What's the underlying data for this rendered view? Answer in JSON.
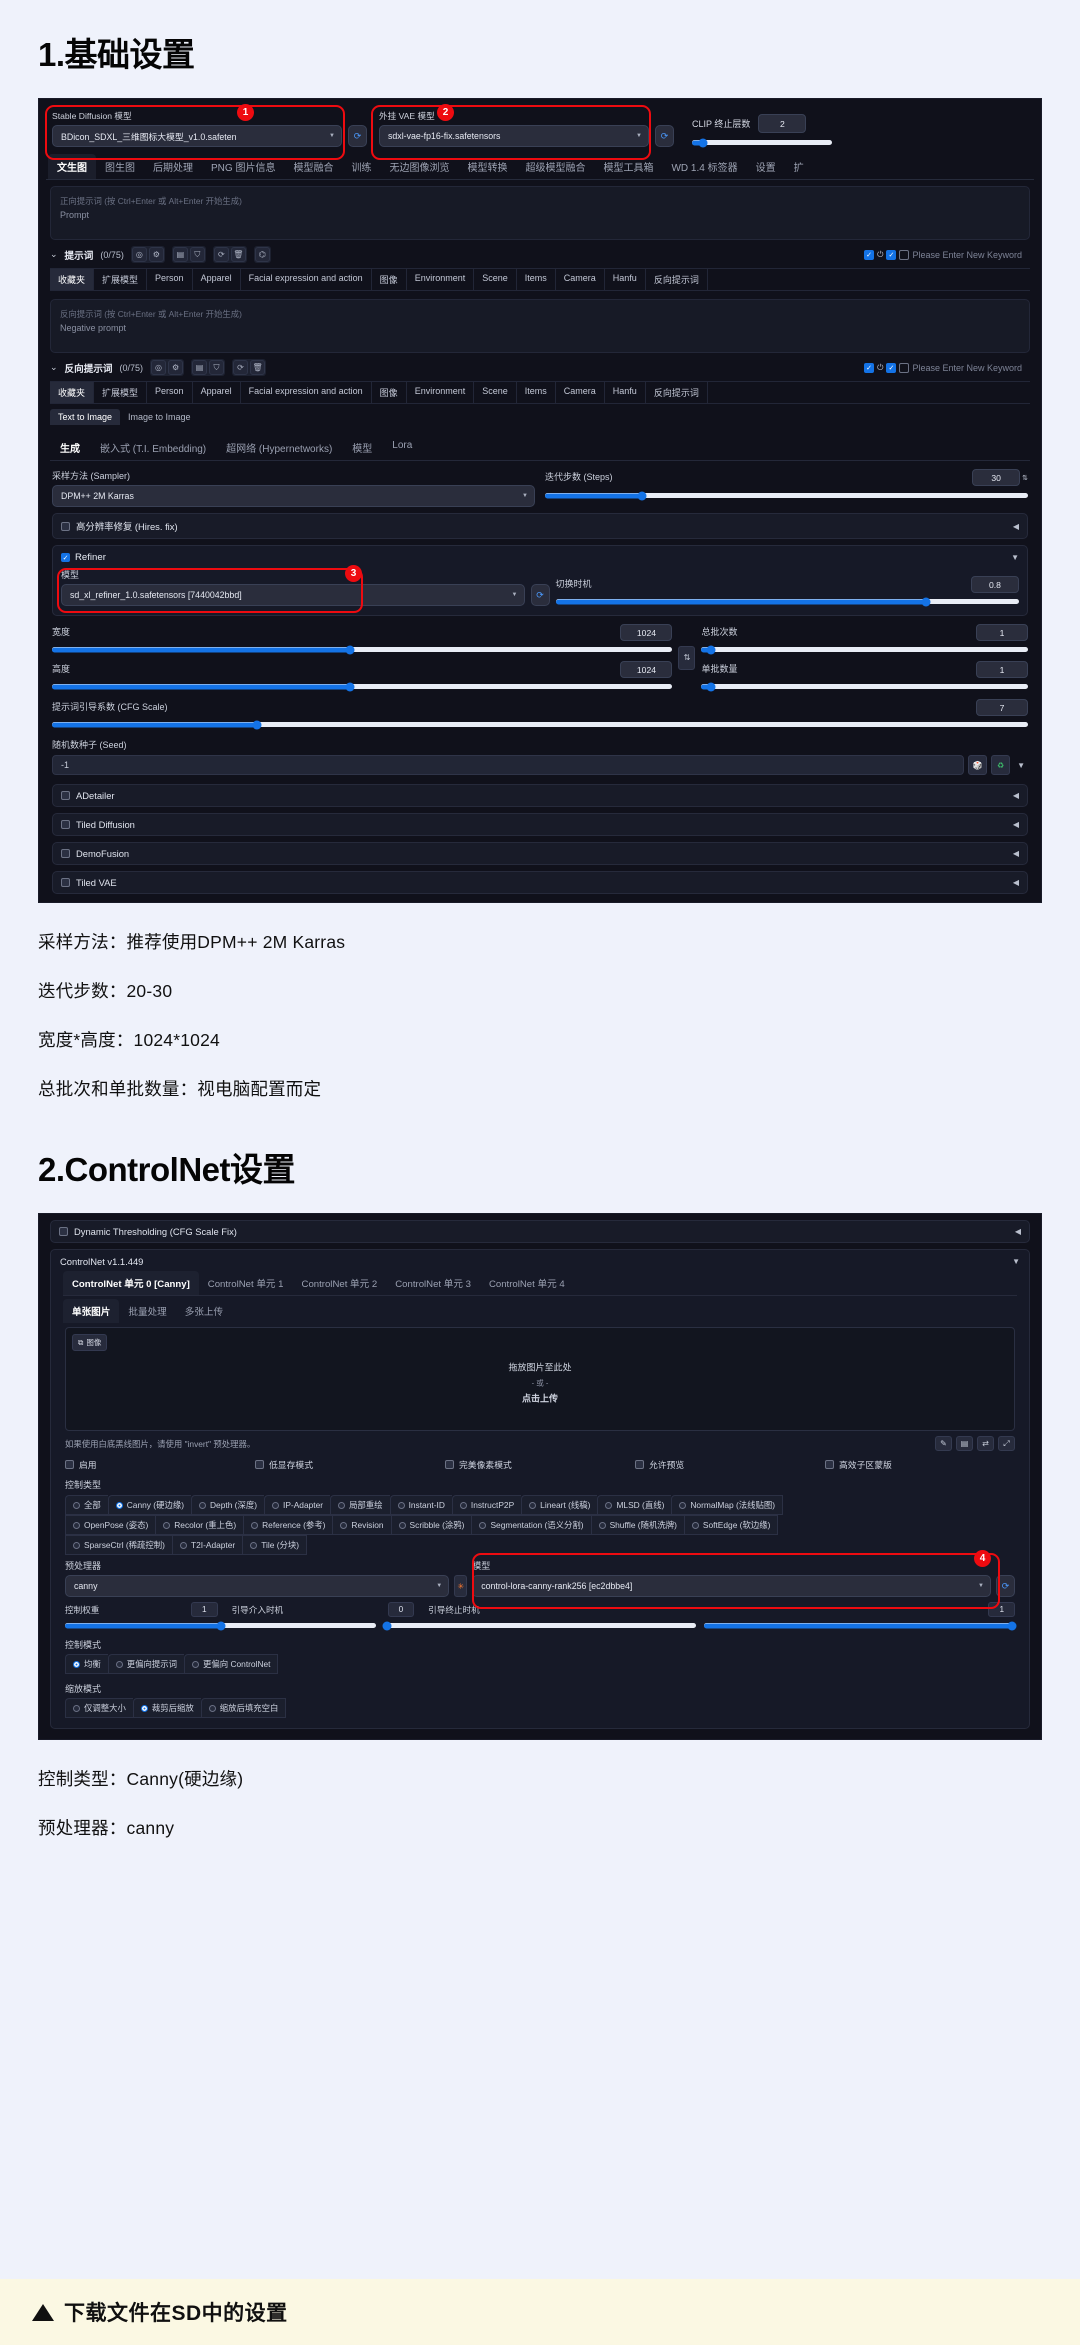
{
  "section1": {
    "heading": "1.基础设置",
    "topbar": {
      "sd_model_label": "Stable Diffusion 模型",
      "sd_model_value": "BDicon_SDXL_三维图标大模型_v1.0.safeten",
      "vae_label": "外挂 VAE 模型",
      "vae_value": "sdxl-vae-fp16-fix.safetensors",
      "clip_label": "CLIP 终止层数",
      "clip_value": "2",
      "refresh_icon": "refresh-icon",
      "badge1": "1",
      "badge2": "2"
    },
    "tabs": [
      "文生图",
      "图生图",
      "后期处理",
      "PNG 图片信息",
      "模型融合",
      "训练",
      "无边图像浏览",
      "模型转换",
      "超级模型融合",
      "模型工具箱",
      "WD 1.4 标签器",
      "设置",
      "扩"
    ],
    "active_tab": "文生图",
    "positive_prompt": {
      "hint": "正向提示词 (按 Ctrl+Enter 或 Alt+Enter 开始生成)",
      "placeholder": "Prompt",
      "title": "提示词",
      "count": "(0/75)",
      "keyword_placeholder": "Please Enter New Keyword"
    },
    "negative_prompt": {
      "hint": "反向提示词 (按 Ctrl+Enter 或 Alt+Enter 开始生成)",
      "placeholder": "Negative prompt",
      "title": "反向提示词",
      "count": "(0/75)",
      "keyword_placeholder": "Please Enter New Keyword"
    },
    "chips": [
      "收藏夹",
      "扩展模型",
      "Person",
      "Apparel",
      "Facial expression and action",
      "图像",
      "Environment",
      "Scene",
      "Items",
      "Camera",
      "Hanfu",
      "反向提示词"
    ],
    "subtabs": [
      "Text to Image",
      "Image to Image"
    ],
    "gen_tabs": [
      "生成",
      "嵌入式 (T.I. Embedding)",
      "超网络 (Hypernetworks)",
      "模型",
      "Lora"
    ],
    "sampler_label": "采样方法 (Sampler)",
    "sampler_value": "DPM++ 2M Karras",
    "steps_label": "迭代步数 (Steps)",
    "steps_value": "30",
    "hires_label": "高分辨率修复 (Hires. fix)",
    "refiner": {
      "title": "Refiner",
      "model_label": "模型",
      "model_value": "sd_xl_refiner_1.0.safetensors [7440042bbd]",
      "switch_label": "切换时机",
      "switch_value": "0.8",
      "badge3": "3"
    },
    "width_label": "宽度",
    "width_value": "1024",
    "height_label": "高度",
    "height_value": "1024",
    "batch_count_label": "总批次数",
    "batch_count_value": "1",
    "batch_size_label": "单批数量",
    "batch_size_value": "1",
    "swap_icon": "swap-arrows-icon",
    "cfg_label": "提示词引导系数 (CFG Scale)",
    "cfg_value": "7",
    "seed_label": "随机数种子 (Seed)",
    "seed_value": "-1",
    "seed_icons": [
      "dice-icon",
      "recycle-icon",
      "chevron-down-icon"
    ],
    "accordions": [
      "ADetailer",
      "Tiled Diffusion",
      "DemoFusion",
      "Tiled VAE"
    ],
    "captions": [
      "采样方法：推荐使用DPM++ 2M Karras",
      "迭代步数：20-30",
      "宽度*高度：1024*1024",
      "总批次和单批数量：视电脑配置而定"
    ]
  },
  "section2": {
    "heading": "2.ControlNet设置",
    "dynamic_threshold": "Dynamic Thresholding (CFG Scale Fix)",
    "controlnet_version": "ControlNet v1.1.449",
    "unit_tabs": [
      "ControlNet 单元 0 [Canny]",
      "ControlNet 单元 1",
      "ControlNet 单元 2",
      "ControlNet 单元 3",
      "ControlNet 单元 4"
    ],
    "mode_tabs": [
      "单张图片",
      "批量处理",
      "多张上传"
    ],
    "image_badge": "图像",
    "drop_text": "拖放图片至此处",
    "drop_or": "- 或 -",
    "drop_click": "点击上传",
    "invert_hint": "如果使用白底黑线图片，请使用 \"invert\" 预处理器。",
    "checkboxes": [
      "启用",
      "低显存模式",
      "完美像素模式",
      "允许预览",
      "高效子区蒙版"
    ],
    "control_type_label": "控制类型",
    "control_types_row1": [
      "全部",
      "Canny (硬边缘)",
      "Depth (深度)",
      "IP-Adapter",
      "局部重绘",
      "Instant-ID",
      "InstructP2P",
      "Lineart (线稿)",
      "MLSD (直线)",
      "NormalMap (法线贴图)"
    ],
    "control_types_row2": [
      "OpenPose (姿态)",
      "Recolor (重上色)",
      "Reference (参考)",
      "Revision",
      "Scribble (涂鸦)",
      "Segmentation (语义分割)",
      "Shuffle (随机洗牌)",
      "SoftEdge (软边缘)"
    ],
    "control_types_row3": [
      "SparseCtrl (稀疏控制)",
      "T2I-Adapter",
      "Tile (分块)"
    ],
    "selected_control_type": "Canny (硬边缘)",
    "preprocessor_label": "预处理器",
    "preprocessor_value": "canny",
    "model_label": "模型",
    "model_value": "control-lora-canny-rank256 [ec2dbbe4]",
    "badge4": "4",
    "weight_label": "控制权重",
    "weight_value": "1",
    "start_label": "引导介入时机",
    "start_value": "0",
    "end_label": "引导终止时机",
    "end_value": "1",
    "control_mode_label": "控制模式",
    "control_modes": [
      "均衡",
      "更偏向提示词",
      "更偏向 ControlNet"
    ],
    "selected_control_mode": "均衡",
    "resize_mode_label": "缩放模式",
    "resize_modes": [
      "仅调整大小",
      "裁剪后缩放",
      "缩放后填充空白"
    ],
    "selected_resize_mode": "裁剪后缩放",
    "captions": [
      "控制类型：Canny(硬边缘)",
      "预处理器：canny"
    ]
  },
  "footer": {
    "triangle_icon": "triangle-up-icon",
    "text": "下载文件在SD中的设置"
  },
  "colors": {
    "accent_red": "#ee0b10",
    "accent_blue": "#1473e6",
    "page_bg": "#eff2fb",
    "footer_bg": "#fbf8e3",
    "panel_bg": "#10111b"
  }
}
